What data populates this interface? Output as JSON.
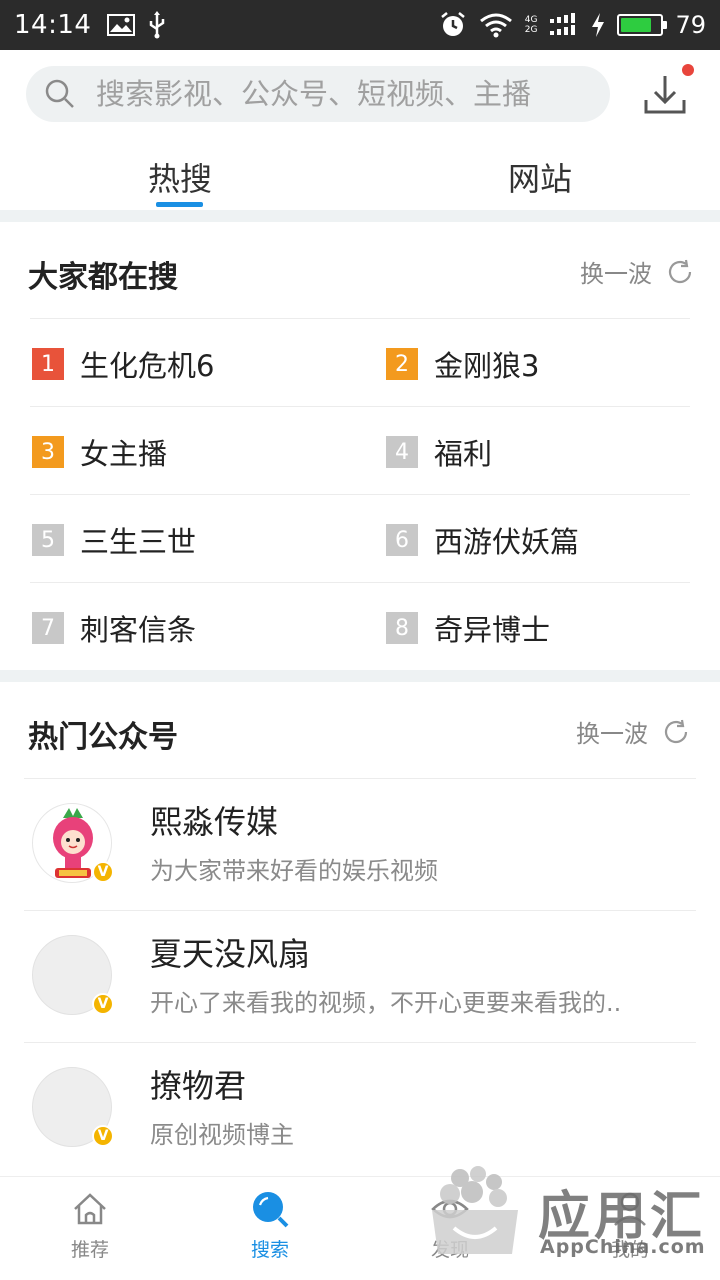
{
  "status_bar": {
    "time": "14:14",
    "battery": "79",
    "battery_level": 0.79,
    "network_top": "4G",
    "network_bottom": "2G"
  },
  "search": {
    "placeholder": "搜索影视、公众号、短视频、主播"
  },
  "tabs": [
    {
      "label": "热搜",
      "active": true
    },
    {
      "label": "网站",
      "active": false
    }
  ],
  "hot_search": {
    "title": "大家都在搜",
    "refresh_label": "换一波",
    "items": [
      {
        "rank": "1",
        "text": "生化危机6"
      },
      {
        "rank": "2",
        "text": "金刚狼3"
      },
      {
        "rank": "3",
        "text": "女主播"
      },
      {
        "rank": "4",
        "text": "福利"
      },
      {
        "rank": "5",
        "text": "三生三世"
      },
      {
        "rank": "6",
        "text": "西游伏妖篇"
      },
      {
        "rank": "7",
        "text": "刺客信条"
      },
      {
        "rank": "8",
        "text": "奇异博士"
      }
    ]
  },
  "hot_accounts": {
    "title": "热门公众号",
    "refresh_label": "换一波",
    "items": [
      {
        "name": "熙淼传媒",
        "desc": "为大家带来好看的娱乐视频",
        "badge": "V"
      },
      {
        "name": "夏天没风扇",
        "desc": "开心了来看我的视频，不开心更要来看我的..",
        "badge": "V"
      },
      {
        "name": "撩物君",
        "desc": "原创视频博主",
        "badge": "V"
      }
    ]
  },
  "bottom_nav": [
    {
      "label": "推荐",
      "icon": "home-icon"
    },
    {
      "label": "搜索",
      "icon": "search-icon",
      "active": true
    },
    {
      "label": "发现",
      "icon": "eye-icon"
    },
    {
      "label": "我的",
      "icon": "person-icon"
    }
  ],
  "watermark": {
    "title": "应用汇",
    "subtitle": "AppChina.com"
  },
  "colors": {
    "accent": "#1a8fe3",
    "rank_top": "#e8533a",
    "rank_high": "#f39a1e",
    "rank_normal": "#c8c8c8",
    "badge": "#f4b400"
  }
}
